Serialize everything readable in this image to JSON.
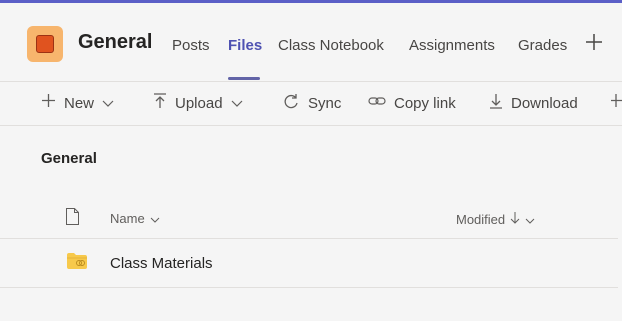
{
  "header": {
    "channel_title": "General",
    "tabs": [
      {
        "label": "Posts",
        "active": false
      },
      {
        "label": "Files",
        "active": true
      },
      {
        "label": "Class Notebook",
        "active": false
      },
      {
        "label": "Assignments",
        "active": false
      },
      {
        "label": "Grades",
        "active": false
      }
    ],
    "add_tab_icon": "plus-icon"
  },
  "toolbar": {
    "new_label": "New",
    "upload_label": "Upload",
    "sync_label": "Sync",
    "copy_link_label": "Copy link",
    "download_label": "Download"
  },
  "content": {
    "breadcrumb": "General",
    "columns": {
      "name": "Name",
      "modified": "Modified"
    },
    "rows": [
      {
        "name": "Class Materials",
        "icon": "folder-icon"
      }
    ]
  },
  "colors": {
    "accent": "#6264a7",
    "team_icon_bg": "#f7b56d",
    "team_icon_inner": "#e0531f",
    "folder": "#f7c94b"
  }
}
